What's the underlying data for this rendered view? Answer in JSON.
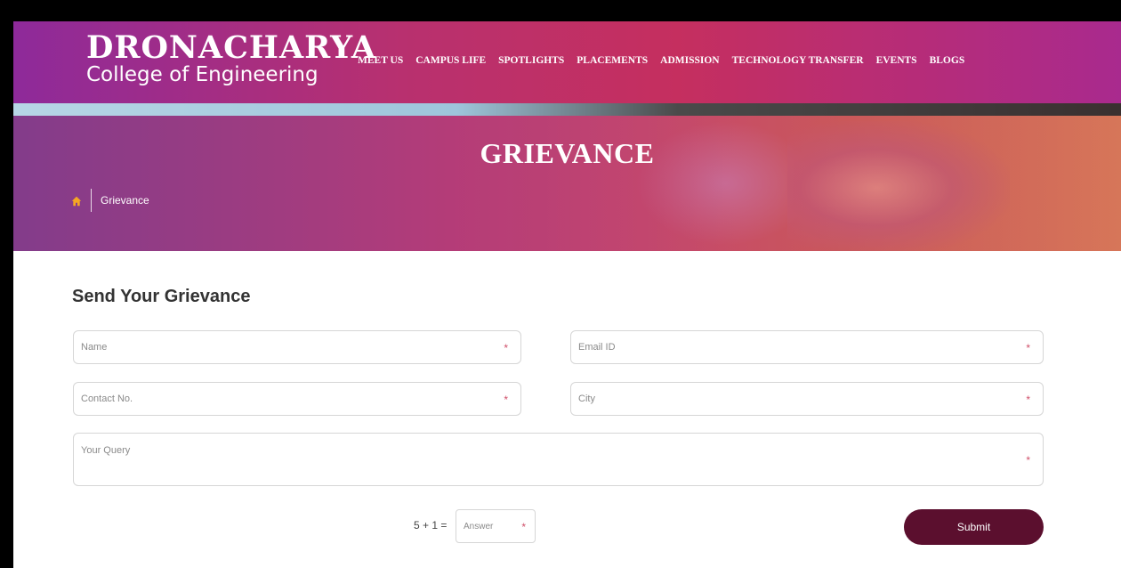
{
  "logo": {
    "main": "DRONACHARYA",
    "sub": "College of Engineering"
  },
  "nav": {
    "items": [
      "MEET US",
      "CAMPUS LIFE",
      "SPOTLIGHTS",
      "PLACEMENTS",
      "ADMISSION",
      "TECHNOLOGY TRANSFER",
      "EVENTS",
      "BLOGS"
    ]
  },
  "banner": {
    "title": "GRIEVANCE",
    "breadcrumb": "Grievance"
  },
  "form": {
    "title": "Send Your Grievance",
    "name_placeholder": "Name",
    "email_placeholder": "Email ID",
    "contact_placeholder": "Contact No.",
    "city_placeholder": "City",
    "query_placeholder": "Your Query",
    "required_mark": "*",
    "captcha_question": "5 + 1 =",
    "captcha_placeholder": "Answer",
    "submit_label": "Submit"
  },
  "colors": {
    "header_start": "#8e2a9a",
    "header_mid": "#c52f5f",
    "submit": "#5b0f2e",
    "home_icon": "#f5a623"
  },
  "icons": {
    "home": "home-icon"
  }
}
